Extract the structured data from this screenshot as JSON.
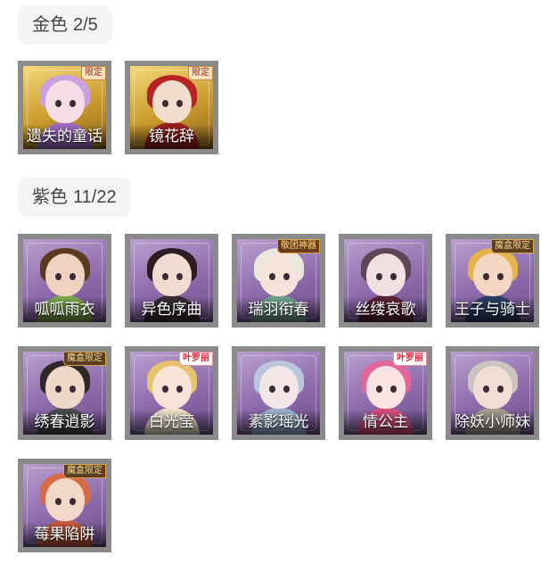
{
  "sections": [
    {
      "label": "金色",
      "count": "2/5"
    },
    {
      "label": "紫色",
      "count": "11/22"
    }
  ],
  "gold_cards": [
    {
      "name": "遗失的童话",
      "badge": "限定",
      "hair": "#c9a0e0",
      "skin": "#f6dde6",
      "body": "#a06bc5"
    },
    {
      "name": "镜花辞",
      "badge": "限定",
      "hair": "#b52323",
      "skin": "#f1dccd",
      "body": "#9a1f1f"
    }
  ],
  "purple_cards": [
    {
      "name": "呱呱雨衣",
      "badge": "",
      "hair": "#5c3a22",
      "skin": "#efd2c0",
      "body": "#7ca84a"
    },
    {
      "name": "异色序曲",
      "badge": "",
      "hair": "#2b1d22",
      "skin": "#f2dcd2",
      "body": "#3a2c35"
    },
    {
      "name": "瑞羽衔春",
      "badge": "敬团神器",
      "hair": "#e8e8df",
      "skin": "#f5e4da",
      "body": "#6fa08a"
    },
    {
      "name": "丝缕哀歌",
      "badge": "",
      "hair": "#5d4655",
      "skin": "#f1e0e2",
      "body": "#5a2334"
    },
    {
      "name": "王子与骑士",
      "badge": "魔盒限定",
      "hair": "#e7b44b",
      "skin": "#f3d7c3",
      "body": "#2a3e63"
    },
    {
      "name": "绣春逍影",
      "badge": "魔盒限定",
      "hair": "#2e2829",
      "skin": "#efd8c8",
      "body": "#4b4a52"
    },
    {
      "name": "白光莹",
      "badge": "叶罗丽",
      "hair": "#e6c36f",
      "skin": "#f7e4d6",
      "body": "#f1e3c9"
    },
    {
      "name": "素影瑶光",
      "badge": "",
      "hair": "#b9c6dc",
      "skin": "#f3e6e6",
      "body": "#9cb2cf"
    },
    {
      "name": "情公主",
      "badge": "叶罗丽",
      "hair": "#e2669a",
      "skin": "#f9e3e3",
      "body": "#d5507f"
    },
    {
      "name": "除妖小师妹",
      "badge": "",
      "hair": "#c9c4c0",
      "skin": "#f0ded4",
      "body": "#a99e93"
    },
    {
      "name": "莓果陷阱",
      "badge": "魔盒限定",
      "hair": "#d86a47",
      "skin": "#f3d8c8",
      "body": "#c45a3b"
    }
  ]
}
